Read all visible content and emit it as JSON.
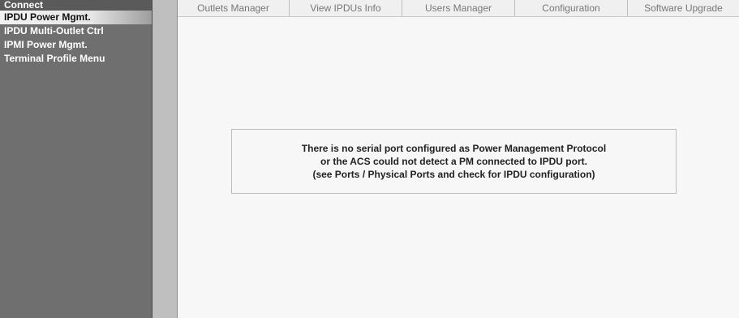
{
  "sidebar": {
    "items": [
      {
        "label": "Connect"
      },
      {
        "label": "IPDU Power Mgmt."
      },
      {
        "label": "IPDU Multi-Outlet Ctrl"
      },
      {
        "label": "IPMI Power Mgmt."
      },
      {
        "label": "Terminal Profile Menu"
      }
    ]
  },
  "tabs": [
    {
      "label": "Outlets Manager"
    },
    {
      "label": "View IPDUs Info"
    },
    {
      "label": "Users Manager"
    },
    {
      "label": "Configuration"
    },
    {
      "label": "Software Upgrade"
    }
  ],
  "message": {
    "lines": [
      "There is no serial port configured as Power Management Protocol",
      "or the ACS could not detect a PM connected to IPDU port.",
      "(see Ports / Physical Ports and check for IPDU configuration)"
    ]
  },
  "colors": {
    "sidebar_bg": "#6f6f6f",
    "active_item_bg": "#e6e6e6",
    "tab_text": "#777777"
  }
}
